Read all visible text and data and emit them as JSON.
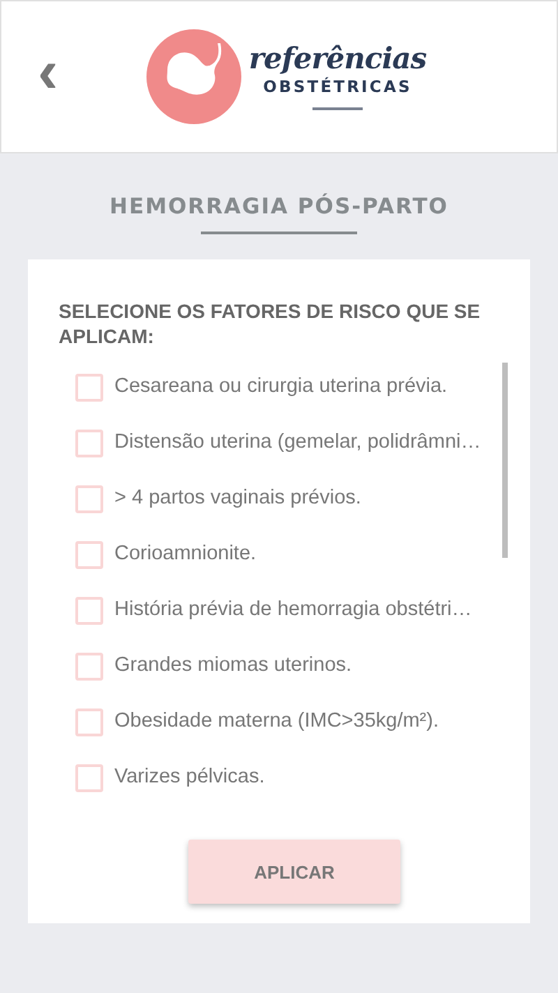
{
  "header": {
    "back": "‹",
    "logo_line_1": "referências",
    "logo_line_2": "OBSTÉTRICAS"
  },
  "title": "HEMORRAGIA PÓS-PARTO",
  "card": {
    "heading": "SELECIONE OS FATORES DE RISCO QUE SE APLICAM:",
    "factors": [
      {
        "label": "Cesareana ou cirurgia uterina prévia.",
        "checked": false
      },
      {
        "label": "Distensão uterina (gemelar, polidrâmni…",
        "checked": false
      },
      {
        "label": "> 4 partos vaginais prévios.",
        "checked": false
      },
      {
        "label": "Corioamnionite.",
        "checked": false
      },
      {
        "label": "História prévia de hemorragia obstétri…",
        "checked": false
      },
      {
        "label": "Grandes miomas uterinos.",
        "checked": false
      },
      {
        "label": "Obesidade materna (IMC>35kg/m²).",
        "checked": false
      },
      {
        "label": "Varizes pélvicas.",
        "checked": false
      }
    ],
    "button": "APLICAR"
  }
}
